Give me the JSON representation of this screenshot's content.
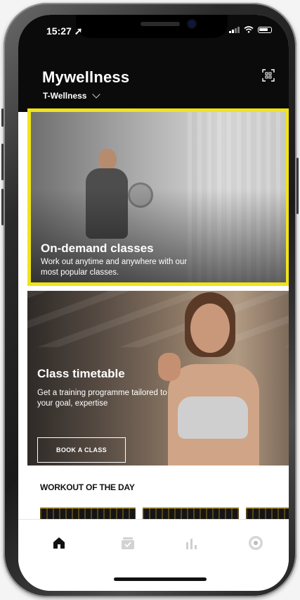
{
  "status_bar": {
    "time": "15:27 ➚"
  },
  "header": {
    "app_title": "Mywellness",
    "club_name": "T-Wellness",
    "qr_icon": "qr-scan-icon"
  },
  "cards": {
    "on_demand": {
      "title": "On-demand classes",
      "description": "Work out anytime and anywhere with our most popular classes.",
      "highlight_color": "#f0e31a"
    },
    "class_timetable": {
      "title": "Class timetable",
      "description": "Get a training programme tailored to your goal, expertise",
      "button_label": "BOOK A CLASS"
    }
  },
  "workout_of_the_day": {
    "title": "WORKOUT OF THE DAY"
  },
  "tab_bar": {
    "items": [
      {
        "icon": "home-icon",
        "active": true
      },
      {
        "icon": "calendar-icon",
        "active": false
      },
      {
        "icon": "stats-icon",
        "active": false
      },
      {
        "icon": "profile-icon",
        "active": false
      }
    ]
  }
}
